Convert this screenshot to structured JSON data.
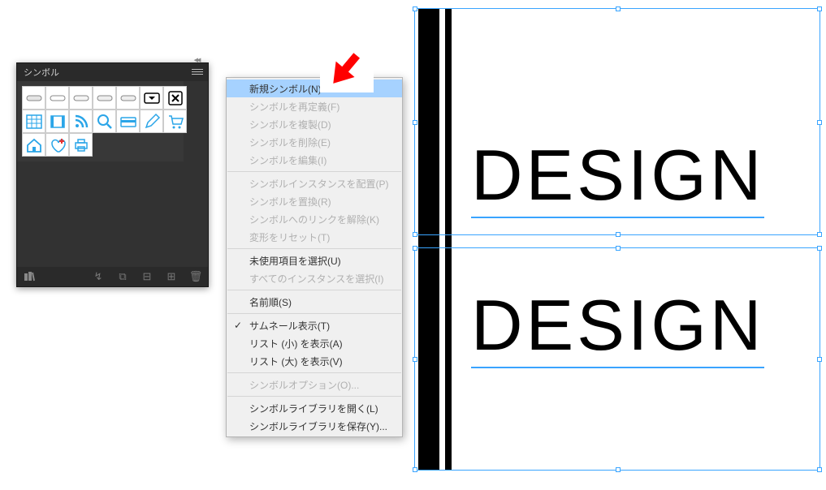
{
  "panel": {
    "title": "シンボル",
    "symbols": [
      "rounded-rect-1",
      "rounded-rect-2",
      "rounded-rect-3",
      "rounded-rect-4",
      "rounded-rect-5",
      "dropdown",
      "close-x",
      "calendar-grid",
      "filmstrip",
      "rss",
      "magnifier",
      "credit-card",
      "pencil",
      "shopping-cart",
      "home",
      "heart-plus",
      "printer"
    ]
  },
  "menu": {
    "items": [
      {
        "label": "新規シンボル(N)...",
        "enabled": true,
        "highlighted": true
      },
      {
        "label": "シンボルを再定義(F)",
        "enabled": false
      },
      {
        "label": "シンボルを複製(D)",
        "enabled": false
      },
      {
        "label": "シンボルを削除(E)",
        "enabled": false
      },
      {
        "label": "シンボルを編集(I)",
        "enabled": false
      },
      {
        "sep": true
      },
      {
        "label": "シンボルインスタンスを配置(P)",
        "enabled": false
      },
      {
        "label": "シンボルを置換(R)",
        "enabled": false
      },
      {
        "label": "シンボルへのリンクを解除(K)",
        "enabled": false
      },
      {
        "label": "変形をリセット(T)",
        "enabled": false
      },
      {
        "sep": true
      },
      {
        "label": "未使用項目を選択(U)",
        "enabled": true
      },
      {
        "label": "すべてのインスタンスを選択(I)",
        "enabled": false
      },
      {
        "sep": true
      },
      {
        "label": "名前順(S)",
        "enabled": true
      },
      {
        "sep": true
      },
      {
        "label": "サムネール表示(T)",
        "enabled": true,
        "checked": true
      },
      {
        "label": "リスト (小) を表示(A)",
        "enabled": true
      },
      {
        "label": "リスト (大) を表示(V)",
        "enabled": true
      },
      {
        "sep": true
      },
      {
        "label": "シンボルオプション(O)...",
        "enabled": false
      },
      {
        "sep": true
      },
      {
        "label": "シンボルライブラリを開く(L)",
        "enabled": true
      },
      {
        "label": "シンボルライブラリを保存(Y)...",
        "enabled": true
      }
    ]
  },
  "canvas": {
    "text1": "DESIGN",
    "text2": "DESIGN"
  },
  "colors": {
    "selection": "#39a4ff",
    "panel_bg": "#323232",
    "menu_highlight": "#a6d2ff",
    "arrow": "#ff0000"
  }
}
